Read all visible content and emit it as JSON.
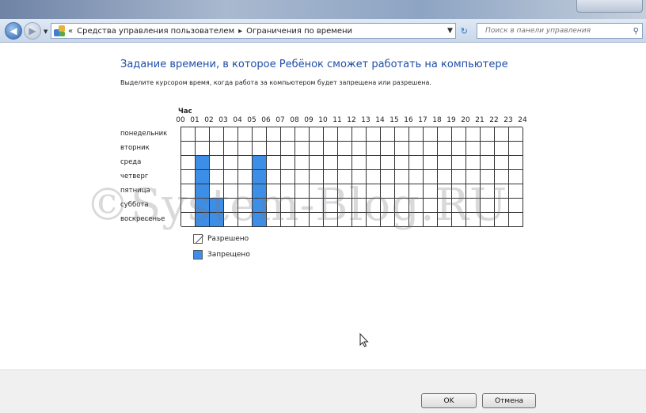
{
  "address_bar": {
    "overflow_marker": "«",
    "breadcrumbs": [
      "Средства управления пользователем",
      "Ограничения по времени"
    ],
    "search_placeholder": "Поиск в панели управления"
  },
  "page": {
    "title": "Задание времени, в которое Ребёнок сможет работать на компьютере",
    "description": "Выделите курсором время, когда работа за компьютером будет запрещена или разрешена."
  },
  "schedule": {
    "hour_caption": "Час",
    "hours": [
      "00",
      "01",
      "02",
      "03",
      "04",
      "05",
      "06",
      "07",
      "08",
      "09",
      "10",
      "11",
      "12",
      "13",
      "14",
      "15",
      "16",
      "17",
      "18",
      "19",
      "20",
      "21",
      "22",
      "23",
      "24"
    ],
    "days": [
      "понедельник",
      "вторник",
      "среда",
      "четверг",
      "пятница",
      "суббота",
      "воскресенье"
    ],
    "blocked_slots": [
      {
        "day": 2,
        "hour": 1
      },
      {
        "day": 2,
        "hour": 5
      },
      {
        "day": 3,
        "hour": 1
      },
      {
        "day": 3,
        "hour": 5
      },
      {
        "day": 4,
        "hour": 1
      },
      {
        "day": 4,
        "hour": 5
      },
      {
        "day": 5,
        "hour": 1
      },
      {
        "day": 5,
        "hour": 2
      },
      {
        "day": 5,
        "hour": 5
      },
      {
        "day": 6,
        "hour": 1
      },
      {
        "day": 6,
        "hour": 2
      },
      {
        "day": 6,
        "hour": 5
      }
    ],
    "colors": {
      "allowed": "#ffffff",
      "blocked": "#3d8ee6"
    }
  },
  "legend": {
    "allowed_label": "Разрешено",
    "blocked_label": "Запрещено"
  },
  "watermark": "©System-Blog.RU",
  "buttons": {
    "ok_label": "OK",
    "cancel_label": "Отмена"
  }
}
